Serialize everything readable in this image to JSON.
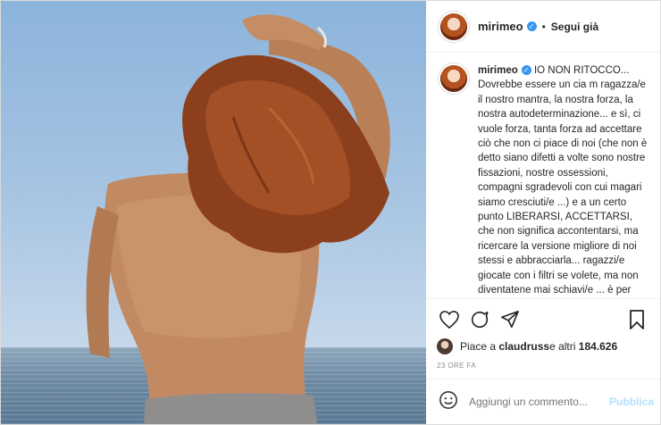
{
  "post": {
    "username": "mirimeo",
    "follow_label": "Segui già",
    "separator": "•",
    "caption_title": "IO NON RITOCCO...",
    "caption_body": "Dovrebbe essere un cia m ragazza/e il nostro mantra, la nostra forza, la nostra autodeterminazione... e sì, ci vuole forza, tanta forza ad accettare ciò che non ci piace di noi (che non è detto siano difetti a volte sono nostre fissazioni, nostre ossessioni, compagni sgradevoli con cui magari siamo cresciuti/e ...) e a un certo punto LIBERARSI, ACCETTARSI, che non significa accontentarsi, ma ricercare la versione migliore di noi stessi e abbracciarla... ragazzi/e giocate con i filtri se volete, ma non diventatene mai schiavi/e ... è per questo che mostro da sempre foto di me senza trucco, naturali, cerco la luce, ma mai la falsità...adesso, intanto, respiro un po'",
    "likes_prefix": "Piace a ",
    "likes_user": "claudruss",
    "likes_suffix": " e altri ",
    "likes_count": "184.626",
    "timestamp": "23 ORE FA",
    "comment_placeholder": "Aggiungi un commento...",
    "publish_label": "Pubblica"
  },
  "colors": {
    "verified": "#3897f0",
    "publish_disabled": "#b2dffc"
  }
}
